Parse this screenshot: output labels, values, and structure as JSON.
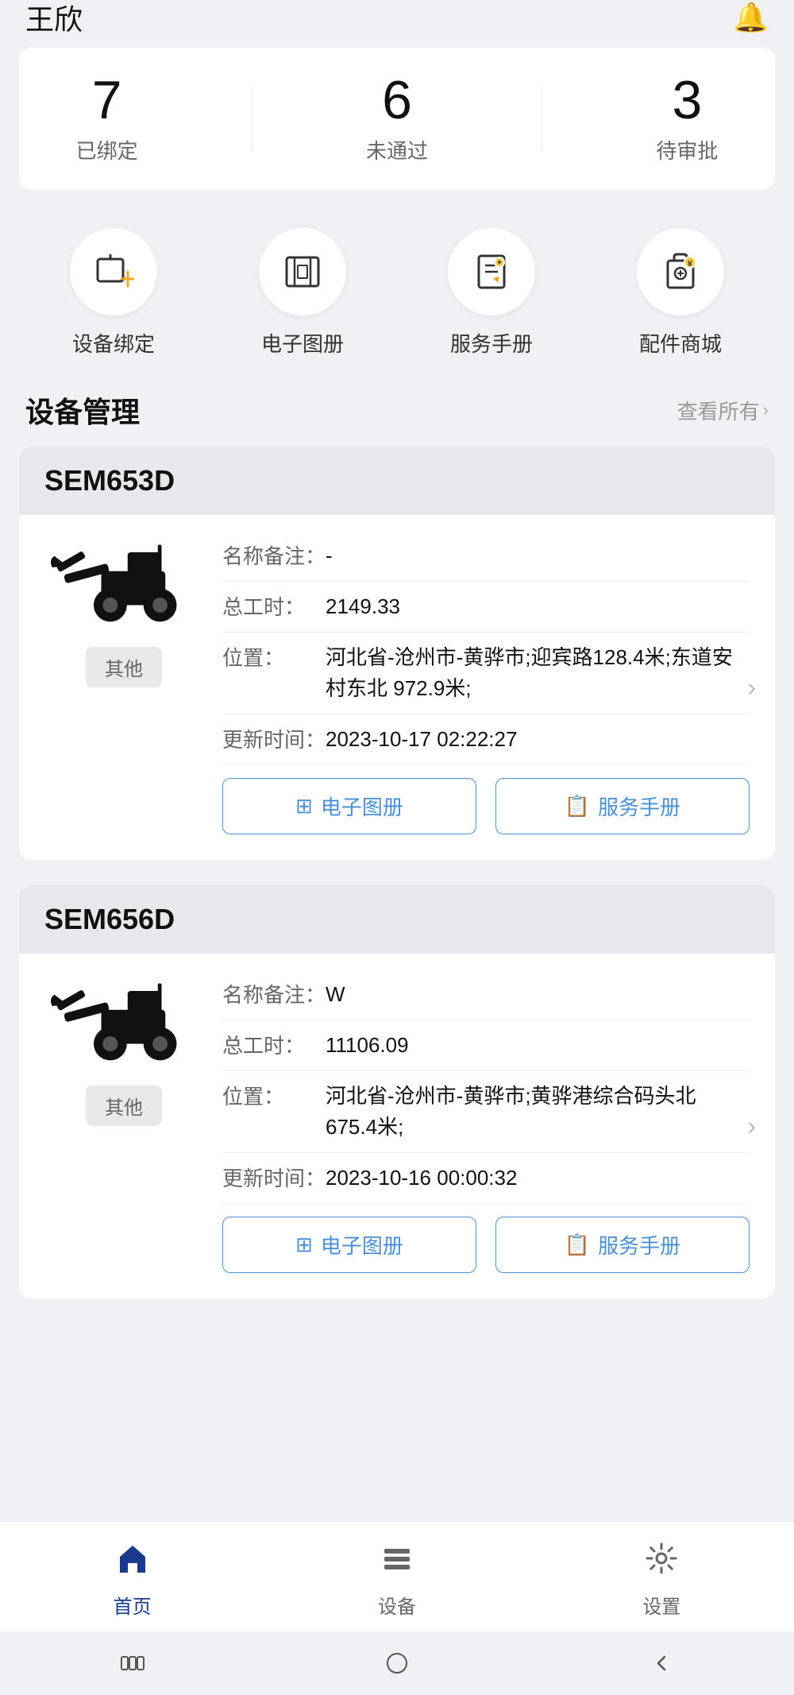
{
  "header": {
    "username": "王欣",
    "bell_label": "notification-bell"
  },
  "stats": {
    "items": [
      {
        "number": "7",
        "label": "已绑定"
      },
      {
        "number": "6",
        "label": "未通过"
      },
      {
        "number": "3",
        "label": "待审批"
      }
    ]
  },
  "quick_actions": {
    "items": [
      {
        "key": "device-bind",
        "label": "设备绑定"
      },
      {
        "key": "electronic-album",
        "label": "电子图册"
      },
      {
        "key": "service-manual",
        "label": "服务手册"
      },
      {
        "key": "parts-shop",
        "label": "配件商城"
      }
    ]
  },
  "device_management": {
    "title": "设备管理",
    "view_all": "查看所有"
  },
  "devices": [
    {
      "model": "SEM653D",
      "name_note_key": "名称备注：",
      "name_note_val": "-",
      "hours_key": "总工时：",
      "hours_val": "2149.33",
      "location_key": "位置：",
      "location_val": "河北省-沧州市-黄骅市;迎宾路128.4米;东道安村东北 972.9米;",
      "update_key": "更新时间：",
      "update_val": "2023-10-17 02:22:27",
      "tag": "其他",
      "btn_album": "电子图册",
      "btn_manual": "服务手册"
    },
    {
      "model": "SEM656D",
      "name_note_key": "名称备注：",
      "name_note_val": "W",
      "hours_key": "总工时：",
      "hours_val": "11106.09",
      "location_key": "位置：",
      "location_val": "河北省-沧州市-黄骅市;黄骅港综合码头北 675.4米;",
      "update_key": "更新时间：",
      "update_val": "2023-10-16 00:00:32",
      "tag": "其他",
      "btn_album": "电子图册",
      "btn_manual": "服务手册"
    }
  ],
  "bottom_nav": {
    "items": [
      {
        "key": "home",
        "label": "首页",
        "active": true
      },
      {
        "key": "device",
        "label": "设备",
        "active": false
      },
      {
        "key": "settings",
        "label": "设置",
        "active": false
      }
    ]
  }
}
